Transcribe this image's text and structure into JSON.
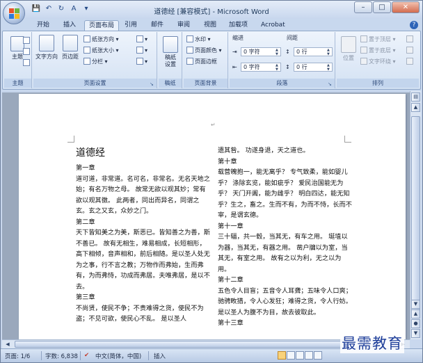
{
  "window": {
    "title": "道德经 [兼容模式] - Microsoft Word",
    "controls": {
      "minimize": "–",
      "maximize": "□",
      "close": "✕"
    }
  },
  "qat": {
    "save_icon": "💾",
    "undo_icon": "↶",
    "redo_icon": "↻",
    "format_icon": "A",
    "customize_icon": "▾"
  },
  "tabs": [
    "开始",
    "插入",
    "页面布局",
    "引用",
    "邮件",
    "审阅",
    "视图",
    "加载项",
    "Acrobat"
  ],
  "active_tab": "页面布局",
  "ribbon": {
    "theme": {
      "label": "主题",
      "big": "主题",
      "group": "主题"
    },
    "page_setup": {
      "group": "页面设置",
      "text_direction": "文字方向",
      "margins": "页边距",
      "orientation": "纸张方向 ▾",
      "size": "纸张大小 ▾",
      "columns": "分栏 ▾",
      "breaks_icon": "▾",
      "line_numbers_icon": "▾",
      "hyphenation_icon": "▾"
    },
    "draft": {
      "group": "稿纸",
      "button": "稿纸设置"
    },
    "page_background": {
      "group": "页面背景",
      "watermark": "水印 ▾",
      "page_color": "页面颜色 ▾",
      "page_borders": "页面边框"
    },
    "paragraph": {
      "group": "段落",
      "indent_label": "缩进",
      "spacing_label": "间距",
      "indent_left": "0 字符",
      "indent_right": "0 字符",
      "spacing_before": "0 行",
      "spacing_after": "0 行"
    },
    "arrange": {
      "group": "排列",
      "position": "位置",
      "bring_front": "置于顶层 ▾",
      "send_back": "置于底层 ▾",
      "wrap_text": "文字环绕 ▾"
    }
  },
  "document": {
    "title": "道德经",
    "left_column": [
      "第一章",
      "道可道，非常道。名可名，非常名。无名天地之始；有名万物之母。 故常无欲以观其妙；常有欲以观其徼。 此两者，同出而异名，同谓之玄。玄之又玄，众妙之门。",
      "第二章",
      "天下皆知美之为美，斯恶已。皆知善之为善，斯不善已。 故有无相生，难易相成，长短相形，高下相倾，音声相和，前后相随。是以圣人处无为之事，行不言之教；万物作而弗始，生而弗有，为而弗恃，功成而弗居。夫唯弗居，是以不去。",
      "第三章",
      "不尚贤，使民不争；不贵难得之货，使民不为盗；不见可欲，使民心不乱。 是以圣人"
    ],
    "right_column": [
      "遗其咎。 功遂身退，天之道也。",
      "第十章",
      "载营魄抱一，能无离乎？ 专气致柔，能如婴儿乎？ 涤除玄览，能如疵乎？ 爱民治国能无为乎？ 天门开阖，能为雌乎？ 明白四达，能无知乎？生之，畜之。生而不有，为而不恃，长而不宰，是谓玄德。",
      "第十一章",
      "三十辐，共一毂，当其无，有车之用。 埏埴以为器，当其无，有器之用。 凿户牖以为室，当其无，有室之用。 故有之以为利，无之以为用。",
      "第十二章",
      "五色令人目盲；五音令人耳聋；五味令人口爽；驰骋畋猎，令人心发狂；难得之货，令人行妨。是以圣人为腹不为目，故去彼取此。",
      "第十三章"
    ]
  },
  "statusbar": {
    "page": "页面: 1/6",
    "words": "字数: 6,838",
    "proof_icon": "✔",
    "language": "中文(简体，中国)",
    "mode": "插入"
  },
  "watermark": "最需教育"
}
